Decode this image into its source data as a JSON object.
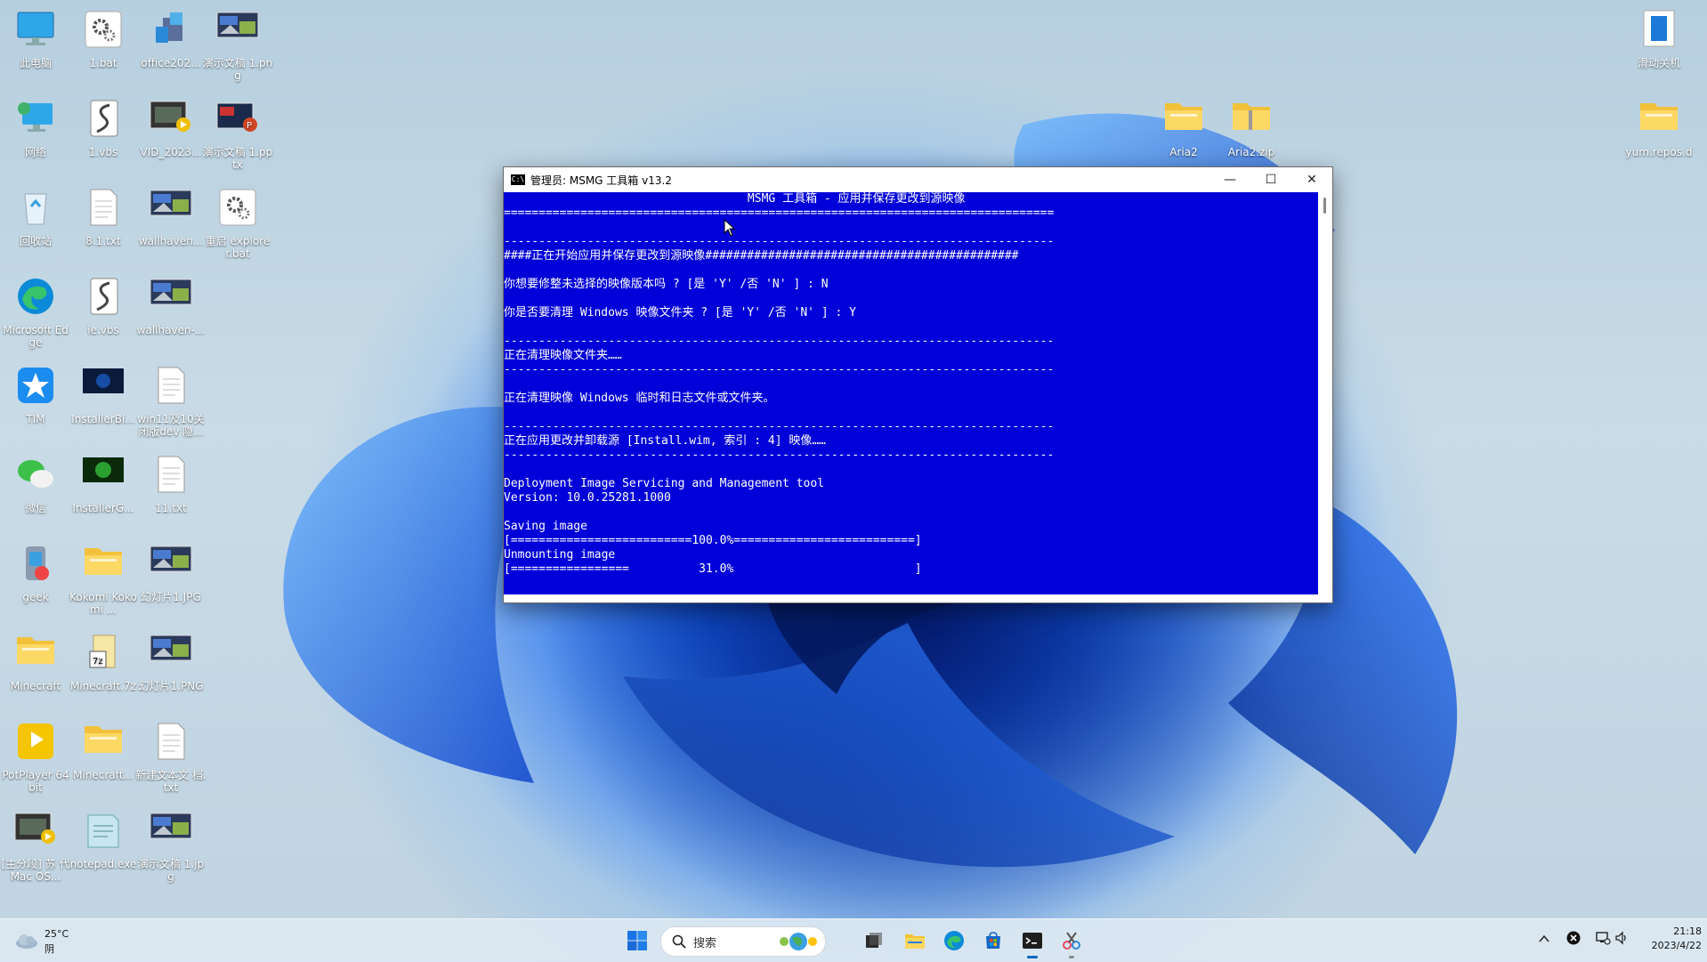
{
  "desktop": {
    "icons": [
      {
        "label": "此电脑",
        "icon": "computer-icon"
      },
      {
        "label": "1.bat",
        "icon": "bat-gear-icon"
      },
      {
        "label": "office202...",
        "icon": "office-install-icon"
      },
      {
        "label": "演示文稿 1.png",
        "icon": "image-file-icon"
      },
      {
        "label": "网络",
        "icon": "network-icon"
      },
      {
        "label": "1.vbs",
        "icon": "vbs-script-icon"
      },
      {
        "label": "VID_2023...",
        "icon": "video-file-icon"
      },
      {
        "label": "演示文稿 1.pptx",
        "icon": "pptx-file-icon"
      },
      {
        "label": "回收站",
        "icon": "recycle-bin-icon"
      },
      {
        "label": "8.1.txt",
        "icon": "text-file-icon"
      },
      {
        "label": "wallhaven...",
        "icon": "image-file-icon"
      },
      {
        "label": "重启 explorer.bat",
        "icon": "bat-gear-icon"
      },
      {
        "label": "Microsoft Edge",
        "icon": "edge-icon"
      },
      {
        "label": "ie.vbs",
        "icon": "vbs-script-icon"
      },
      {
        "label": "wallhaven-...",
        "icon": "image-file-icon"
      },
      {
        "label": "TIM",
        "icon": "tim-icon"
      },
      {
        "label": "InstallerBl...",
        "icon": "installer-icon"
      },
      {
        "label": "win11及10关 闭版dev 隐...",
        "icon": "text-file-icon"
      },
      {
        "label": "微信",
        "icon": "wechat-icon"
      },
      {
        "label": "InstallerG...",
        "icon": "installer-green-icon"
      },
      {
        "label": "11.txt",
        "icon": "text-file-icon"
      },
      {
        "label": "geek",
        "icon": "geek-icon"
      },
      {
        "label": "Kokomi Kokomi ...",
        "icon": "folder-icon"
      },
      {
        "label": "幻灯片1.JPG",
        "icon": "image-file-icon"
      },
      {
        "label": "Minecraft",
        "icon": "folder-icon"
      },
      {
        "label": "Minecraft.7z",
        "icon": "archive-icon"
      },
      {
        "label": "幻灯片1.PNG",
        "icon": "image-file-icon"
      },
      {
        "label": "PotPlayer 64 bit",
        "icon": "potplayer-icon"
      },
      {
        "label": "Minecraft...",
        "icon": "folder-icon"
      },
      {
        "label": "新建文本文 档.txt",
        "icon": "text-file-icon"
      },
      {
        "label": "[主分段] 苏 代Mac OS...",
        "icon": "video-file-icon"
      },
      {
        "label": "notepad.exe",
        "icon": "notepad-icon"
      },
      {
        "label": "演示文稿 1.jpg",
        "icon": "image-file-icon"
      },
      {
        "label": "Aria2",
        "icon": "folder-icon"
      },
      {
        "label": "Aria2.zip",
        "icon": "zip-folder-icon"
      },
      {
        "label": "滑动关机",
        "icon": "shutdown-shortcut-icon"
      },
      {
        "label": "yum.repos.d",
        "icon": "folder-icon"
      }
    ]
  },
  "console": {
    "title": "管理员:  MSMG 工具箱 v13.2",
    "app_icon_text": "C:\\",
    "controls": {
      "minimize": "—",
      "maximize": "☐",
      "close": "✕"
    },
    "lines": [
      "                                   MSMG 工具箱 - 应用并保存更改到源映像",
      "===============================================================================",
      "",
      "-------------------------------------------------------------------------------",
      "####正在开始应用并保存更改到源映像#############################################",
      "",
      "你想要修整未选择的映像版本吗 ? [是 'Y' /否 'N' ] : N",
      "",
      "你是否要清理 Windows 映像文件夹 ? [是 'Y' /否 'N' ] : Y",
      "",
      "-------------------------------------------------------------------------------",
      "正在清理映像文件夹……",
      "-------------------------------------------------------------------------------",
      "",
      "正在清理映像 Windows 临时和日志文件或文件夹。",
      "",
      "-------------------------------------------------------------------------------",
      "正在应用更改并卸载源 [Install.wim, 索引 : 4] 映像……",
      "-------------------------------------------------------------------------------",
      "",
      "Deployment Image Servicing and Management tool",
      "Version: 10.0.25281.1000",
      "",
      "Saving image",
      "[==========================100.0%==========================]",
      "Unmounting image",
      "[=================          31.0%                          ]"
    ]
  },
  "taskbar": {
    "weather_temp": "25°C",
    "weather_desc": "阴",
    "search_placeholder": "搜索",
    "time": "21:18",
    "date": "2023/4/22"
  }
}
